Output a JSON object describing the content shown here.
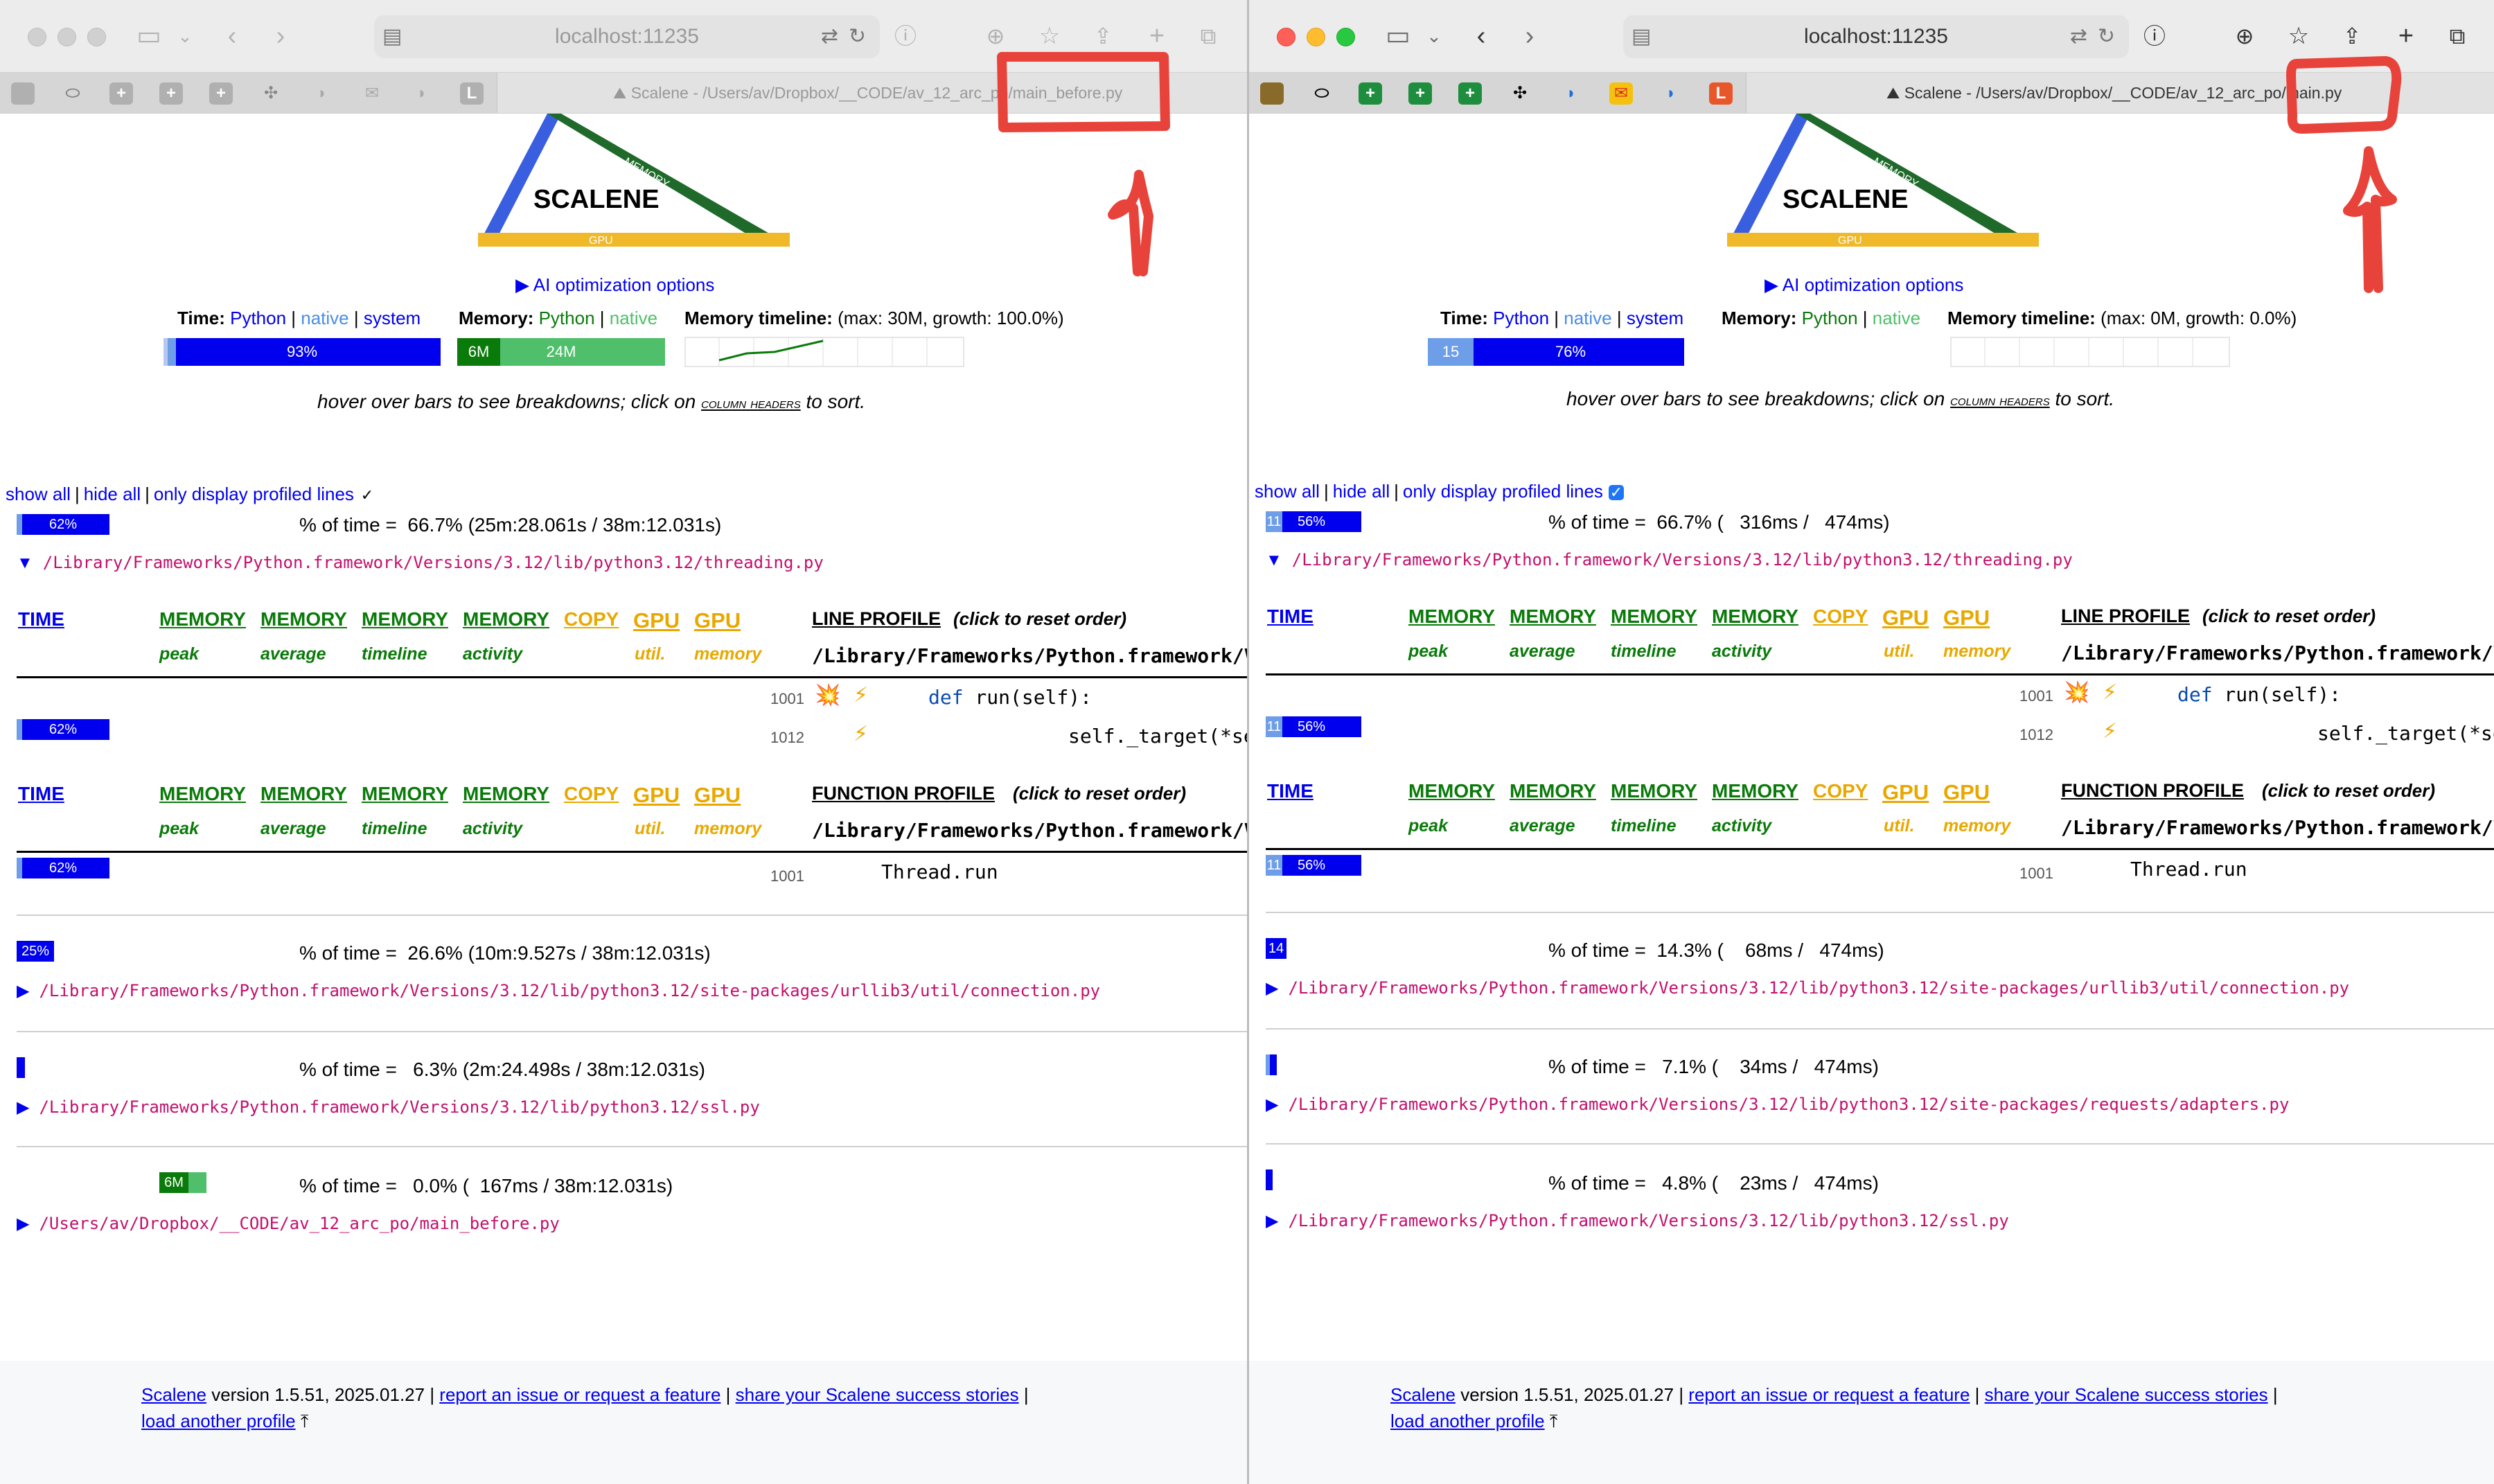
{
  "windows": [
    {
      "url": "localhost:11235",
      "tab_title": "Scalene - /Users/av/Dropbox/__CODE/av_12_arc_po/main_before.py",
      "logo": {
        "title": "SCALENE",
        "cpu": "CPU",
        "memory": "MEMORY",
        "gpu": "GPU"
      },
      "ai_options": "▶ AI optimization options",
      "time_label": "Time:",
      "python": "Python",
      "native": "native",
      "system": "system",
      "memory_label": "Memory:",
      "mem_python": "Python",
      "mem_native": "native",
      "timeline_label": "Memory timeline:",
      "timeline_info": "(max: 30M, growth: 100.0%)",
      "time_bar": {
        "python_pct_label": "93%",
        "native_label": "",
        "python": 0.93,
        "native": 0.03
      },
      "memory_bar": {
        "python_label": "6M",
        "native_label": "24M",
        "python": 0.2,
        "native": 0.8
      },
      "hint_prefix": "hover over bars to see breakdowns; click on ",
      "hint_link": "column headers",
      "hint_suffix": " to sort.",
      "show_all": "show all",
      "hide_all": "hide all",
      "only_profiled": "only display profiled lines",
      "only_profiled_checked": false,
      "files": [
        {
          "bar_label": "62%",
          "bar": 0.62,
          "pct": "% of time =  66.7% (25m:28.061s / 38m:12.031s)",
          "name": "/Library/Frameworks/Python.framework/Versions/3.12/lib/python3.12/threading.py",
          "expanded": true
        },
        {
          "bar_label": "25%",
          "bar": 0.25,
          "pct": "% of time =  26.6% (10m:9.527s / 38m:12.031s)",
          "name": "/Library/Frameworks/Python.framework/Versions/3.12/lib/python3.12/site-packages/urllib3/util/connection.py",
          "expanded": false
        },
        {
          "bar_label": "",
          "bar": 0.06,
          "pct": "% of time =   6.3% (2m:24.498s / 38m:12.031s)",
          "name": "/Library/Frameworks/Python.framework/Versions/3.12/lib/python3.12/ssl.py",
          "expanded": false
        },
        {
          "bar_label": "6M",
          "bar": 0.0,
          "pct": "% of time =   0.0% (  167ms / 38m:12.031s)",
          "name": "/Users/av/Dropbox/__CODE/av_12_arc_po/main_before.py",
          "expanded": false
        }
      ],
      "line_rows": [
        {
          "bar_label": "",
          "lineno": "1001",
          "code_kw": "def",
          "code_rest": " run(self):"
        },
        {
          "bar_label": "62%",
          "lineno": "1012",
          "code_kw": "",
          "code_rest": "self._target(*se"
        }
      ],
      "function_rows": [
        {
          "bar_label": "62%",
          "lineno": "1001",
          "code": "Thread.run"
        }
      ],
      "footer": {
        "scalene": "Scalene",
        "version": " version 1.5.51, 2025.01.27  |  ",
        "report": "report an issue or request a feature",
        "sep1": "  |  ",
        "share": "share your Scalene success stories",
        "sep2": "  |",
        "load": "load another profile"
      }
    },
    {
      "url": "localhost:11235",
      "tab_title": "Scalene - /Users/av/Dropbox/__CODE/av_12_arc_po/main.py",
      "logo": {
        "title": "SCALENE",
        "cpu": "CPU",
        "memory": "MEMORY",
        "gpu": "GPU"
      },
      "ai_options": "▶ AI optimization options",
      "time_label": "Time:",
      "python": "Python",
      "native": "native",
      "system": "system",
      "memory_label": "Memory:",
      "mem_python": "Python",
      "mem_native": "native",
      "timeline_label": "Memory timeline:",
      "timeline_info": "(max: 0M, growth: 0.0%)",
      "time_bar": {
        "python_pct_label": "76%",
        "native_label": "15",
        "python": 0.76,
        "native": 0.15
      },
      "memory_bar": {
        "python_label": "",
        "native_label": "",
        "python": 0,
        "native": 0
      },
      "hint_prefix": "hover over bars to see breakdowns; click on ",
      "hint_link": "column headers",
      "hint_suffix": " to sort.",
      "show_all": "show all",
      "hide_all": "hide all",
      "only_profiled": "only display profiled lines",
      "only_profiled_checked": true,
      "files": [
        {
          "bar_label": "56%",
          "native_label": "11",
          "bar": 0.56,
          "pct": "% of time =  66.7% (   316ms /   474ms)",
          "name": "/Library/Frameworks/Python.framework/Versions/3.12/lib/python3.12/threading.py",
          "expanded": true
        },
        {
          "bar_label": "14",
          "bar": 0.14,
          "pct": "% of time =  14.3% (    68ms /   474ms)",
          "name": "/Library/Frameworks/Python.framework/Versions/3.12/lib/python3.12/site-packages/urllib3/util/connection.py",
          "expanded": false
        },
        {
          "bar_label": "",
          "bar": 0.07,
          "pct": "% of time =   7.1% (    34ms /   474ms)",
          "name": "/Library/Frameworks/Python.framework/Versions/3.12/lib/python3.12/site-packages/requests/adapters.py",
          "expanded": false
        },
        {
          "bar_label": "",
          "bar": 0.05,
          "pct": "% of time =   4.8% (    23ms /   474ms)",
          "name": "/Library/Frameworks/Python.framework/Versions/3.12/lib/python3.12/ssl.py",
          "expanded": false
        }
      ],
      "line_rows": [
        {
          "bar_label": "",
          "lineno": "1001",
          "code_kw": "def",
          "code_rest": " run(self):"
        },
        {
          "bar_label": "56%",
          "native_label": "11",
          "lineno": "1012",
          "code_kw": "",
          "code_rest": "self._target(*se"
        }
      ],
      "function_rows": [
        {
          "bar_label": "56%",
          "native_label": "11",
          "lineno": "1001",
          "code": "Thread.run"
        }
      ],
      "footer": {
        "scalene": "Scalene",
        "version": " version 1.5.51, 2025.01.27  |  ",
        "report": "report an issue or request a feature",
        "sep1": "  |  ",
        "share": "share your Scalene success stories",
        "sep2": "  |",
        "load": "load another profile"
      }
    }
  ],
  "table_headers": {
    "time": "TIME",
    "mem_peak": "MEMORY",
    "mem_peak_sub": "peak",
    "mem_avg": "MEMORY",
    "mem_avg_sub": "average",
    "mem_timeline": "MEMORY",
    "mem_timeline_sub": "timeline",
    "mem_activity": "MEMORY",
    "mem_activity_sub": "activity",
    "copy": "COPY",
    "gpu_util": "GPU",
    "gpu_util_sub": "util.",
    "gpu_mem": "GPU",
    "gpu_mem_sub": "memory",
    "line_profile": "LINE PROFILE",
    "line_profile_hint": "(click to reset order)",
    "function_profile": "FUNCTION PROFILE",
    "function_profile_hint": "(click to reset order)",
    "path": "/Library/Frameworks/Python.framework/Ve"
  },
  "icons": {
    "explosion": "💥",
    "bolt": "⚡"
  },
  "colors": {
    "python_time": "#0000ee",
    "native_time": "#6e9ee8",
    "system_time": "#b7c8f0",
    "python_mem": "#0a7a0a",
    "native_mem": "#4fbf6b",
    "annotation": "#e8433a"
  }
}
